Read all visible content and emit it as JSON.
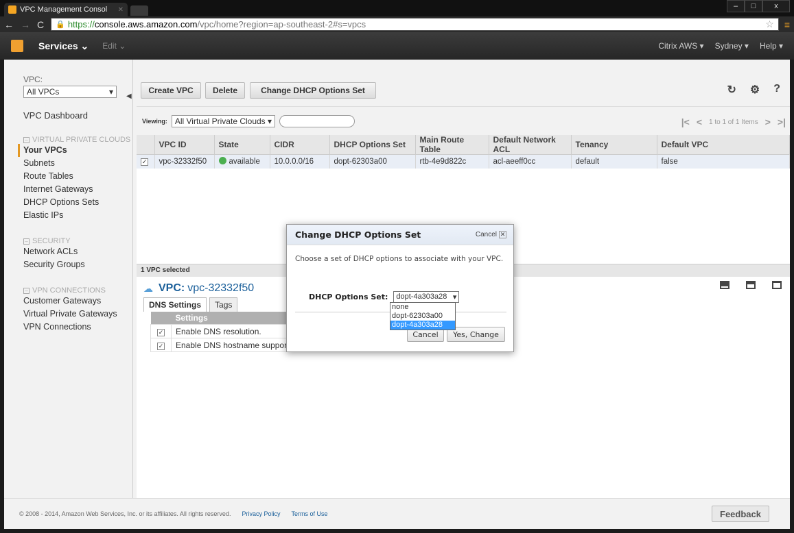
{
  "browser": {
    "tab_title": "VPC Management Consol",
    "url_https": "https://",
    "url_host": "console.aws.amazon.com",
    "url_path": "/vpc/home?region=ap-southeast-2#s=vpcs"
  },
  "awsnav": {
    "services": "Services ⌄",
    "edit": "Edit ⌄",
    "right": [
      "Citrix AWS ▾",
      "Sydney ▾",
      "Help ▾"
    ]
  },
  "sidebar": {
    "vpc_label": "VPC:",
    "vpc_select": "All VPCs",
    "dashboard": "VPC Dashboard",
    "section1": "VIRTUAL PRIVATE CLOUDS",
    "items1": [
      "Your VPCs",
      "Subnets",
      "Route Tables",
      "Internet Gateways",
      "DHCP Options Sets",
      "Elastic IPs"
    ],
    "section2": "SECURITY",
    "items2": [
      "Network ACLs",
      "Security Groups"
    ],
    "section3": "VPN CONNECTIONS",
    "items3": [
      "Customer Gateways",
      "Virtual Private Gateways",
      "VPN Connections"
    ]
  },
  "actions": {
    "create": "Create VPC",
    "delete": "Delete",
    "change_dhcp": "Change DHCP Options Set"
  },
  "viewbar": {
    "viewing": "Viewing:",
    "select": "All Virtual Private Clouds ▾",
    "pager": "1 to 1 of 1 Items"
  },
  "table": {
    "headers": [
      "VPC ID",
      "State",
      "CIDR",
      "DHCP Options Set",
      "Main Route Table",
      "Default Network ACL",
      "Tenancy",
      "Default VPC"
    ],
    "row": [
      "vpc-32332f50",
      "available",
      "10.0.0.0/16",
      "dopt-62303a00",
      "rtb-4e9d822c",
      "acl-aeeff0cc",
      "default",
      "false"
    ]
  },
  "detail": {
    "selected": "1 VPC selected",
    "vpc_label": "VPC:",
    "vpc_id": "vpc-32332f50",
    "tabs": [
      "DNS Settings",
      "Tags"
    ],
    "settings_header": "Settings",
    "settings": [
      "Enable DNS resolution.",
      "Enable DNS hostname support for instances launched in this VPC."
    ]
  },
  "modal": {
    "title": "Change DHCP Options Set",
    "cancel_link": "Cancel",
    "text": "Choose a set of DHCP options to associate with your VPC.",
    "label": "DHCP Options Set:",
    "selected": "dopt-4a303a28",
    "options": [
      "none",
      "dopt-62303a00",
      "dopt-4a303a28"
    ],
    "cancel_button": "Cancel",
    "confirm_button": "Yes, Change"
  },
  "footer": {
    "copyright": "© 2008 - 2014, Amazon Web Services, Inc. or its affiliates. All rights reserved.",
    "privacy": "Privacy Policy",
    "terms": "Terms of Use",
    "feedback": "Feedback"
  },
  "colors": {
    "accent": "#e39823",
    "link": "#1a5f9a",
    "selection": "#3399ff"
  }
}
